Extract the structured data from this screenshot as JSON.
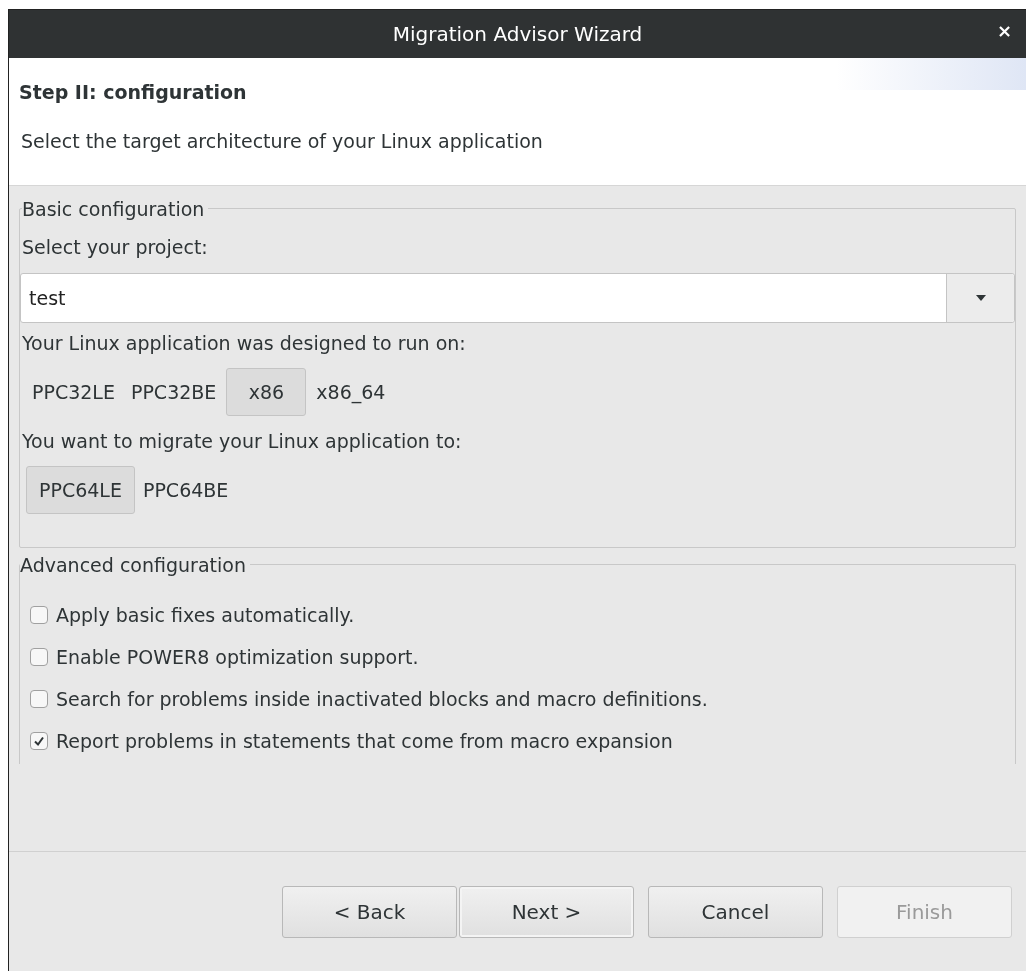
{
  "window": {
    "title": "Migration Advisor Wizard",
    "close": "×"
  },
  "header": {
    "title": "Step II: configuration",
    "description": "Select the target architecture of your Linux application"
  },
  "basic": {
    "legend": "Basic configuration",
    "project_label": "Select your project:",
    "project": {
      "value": "test"
    },
    "source_label": "Your Linux application was designed to run on:",
    "source_options": [
      {
        "label": "PPC32LE",
        "selected": false
      },
      {
        "label": "PPC32BE",
        "selected": false
      },
      {
        "label": "x86",
        "selected": true
      },
      {
        "label": "x86_64",
        "selected": false
      }
    ],
    "target_label": "You want to migrate your Linux application to:",
    "target_options": [
      {
        "label": "PPC64LE",
        "selected": true
      },
      {
        "label": "PPC64BE",
        "selected": false
      }
    ]
  },
  "advanced": {
    "legend": "Advanced configuration",
    "options": [
      {
        "label": "Apply basic fixes automatically.",
        "checked": false
      },
      {
        "label": "Enable POWER8 optimization support.",
        "checked": false
      },
      {
        "label": "Search for problems inside inactivated blocks and macro definitions.",
        "checked": false
      },
      {
        "label": "Report problems in statements that come from macro expansion",
        "checked": true
      }
    ]
  },
  "buttons": [
    {
      "label": "< Back",
      "disabled": false,
      "default": false
    },
    {
      "label": "Next >",
      "disabled": false,
      "default": true
    },
    {
      "label": "Cancel",
      "disabled": false,
      "default": false
    },
    {
      "label": "Finish",
      "disabled": true,
      "default": false
    }
  ]
}
